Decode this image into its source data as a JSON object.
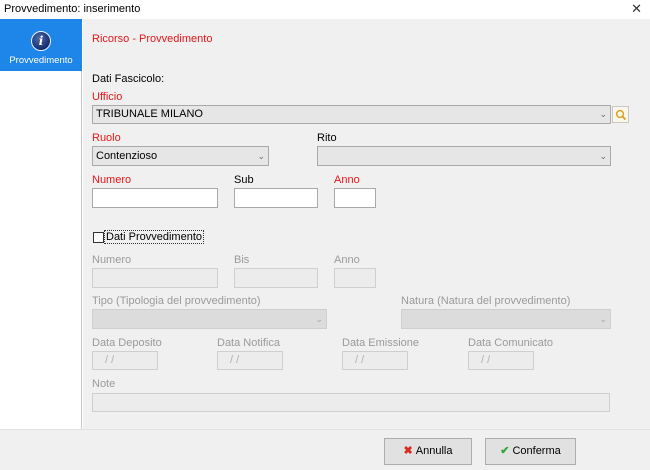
{
  "window": {
    "title": "Provvedimento: inserimento",
    "close_glyph": "✕"
  },
  "sidebar": {
    "items": [
      {
        "label": "Provvedimento",
        "icon": "info-icon",
        "icon_glyph": "i"
      }
    ]
  },
  "section": {
    "title": "Ricorso - Provvedimento"
  },
  "fascicolo": {
    "heading": "Dati Fascicolo:",
    "ufficio": {
      "label": "Ufficio",
      "value": "TRIBUNALE MILANO"
    },
    "ruolo": {
      "label": "Ruolo",
      "value": "Contenzioso"
    },
    "rito": {
      "label": "Rito",
      "value": ""
    },
    "numero": {
      "label": "Numero",
      "value": ""
    },
    "sub": {
      "label": "Sub",
      "value": ""
    },
    "anno": {
      "label": "Anno",
      "value": ""
    }
  },
  "provvedimento": {
    "checkbox_label": "Dati Provvedimento",
    "checked": false,
    "numero": {
      "label": "Numero"
    },
    "bis": {
      "label": "Bis"
    },
    "anno": {
      "label": "Anno"
    },
    "tipo": {
      "label": "Tipo (Tipologia del provvedimento)"
    },
    "natura": {
      "label": "Natura (Natura del provvedimento)"
    },
    "data_deposito": {
      "label": "Data Deposito",
      "placeholder": "/   /"
    },
    "data_notifica": {
      "label": "Data Notifica",
      "placeholder": "/   /"
    },
    "data_emissione": {
      "label": "Data Emissione",
      "placeholder": "/   /"
    },
    "data_comunicato": {
      "label": "Data Comunicato",
      "placeholder": "/   /"
    },
    "note": {
      "label": "Note"
    }
  },
  "footer": {
    "cancel_label": "Annulla",
    "confirm_label": "Conferma"
  },
  "colors": {
    "accent": "#1e86e8",
    "required": "#e8161a",
    "cancel_icon": "#d72c22",
    "confirm_icon": "#31a83a"
  }
}
